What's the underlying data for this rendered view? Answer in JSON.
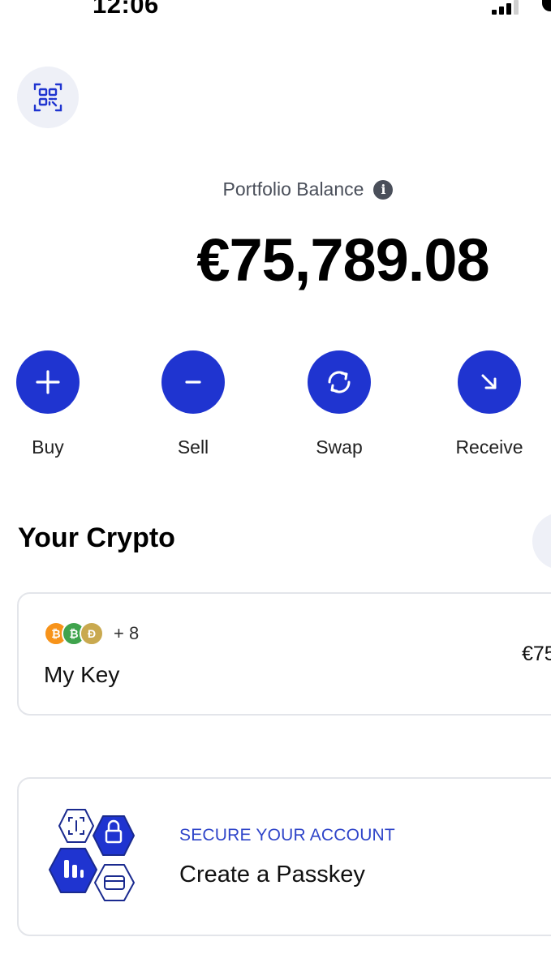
{
  "status_bar": {
    "time": "12:06"
  },
  "colors": {
    "accent": "#1f34d0",
    "muted_bg": "#eef0f7",
    "eyebrow": "#2f45c9"
  },
  "header": {
    "qr_icon": "qr-scan-icon"
  },
  "balance": {
    "label": "Portfolio Balance",
    "info_icon": "info-icon",
    "info_glyph": "i",
    "value": "€75,789.08"
  },
  "actions": [
    {
      "label": "Buy",
      "icon": "plus-icon"
    },
    {
      "label": "Sell",
      "icon": "minus-icon"
    },
    {
      "label": "Swap",
      "icon": "swap-icon"
    },
    {
      "label": "Receive",
      "icon": "arrow-down-right-icon"
    }
  ],
  "crypto": {
    "title": "Your Crypto",
    "key_card": {
      "coins": [
        {
          "symbol": "₿",
          "color": "#f7931a"
        },
        {
          "symbol": "₿",
          "color": "#3fa34d"
        },
        {
          "symbol": "Ð",
          "color": "#c9a94f"
        }
      ],
      "extra_count": "+ 8",
      "name": "My Key",
      "value_partial": "€75"
    }
  },
  "passkey_card": {
    "eyebrow": "SECURE YOUR ACCOUNT",
    "title": "Create a Passkey"
  }
}
